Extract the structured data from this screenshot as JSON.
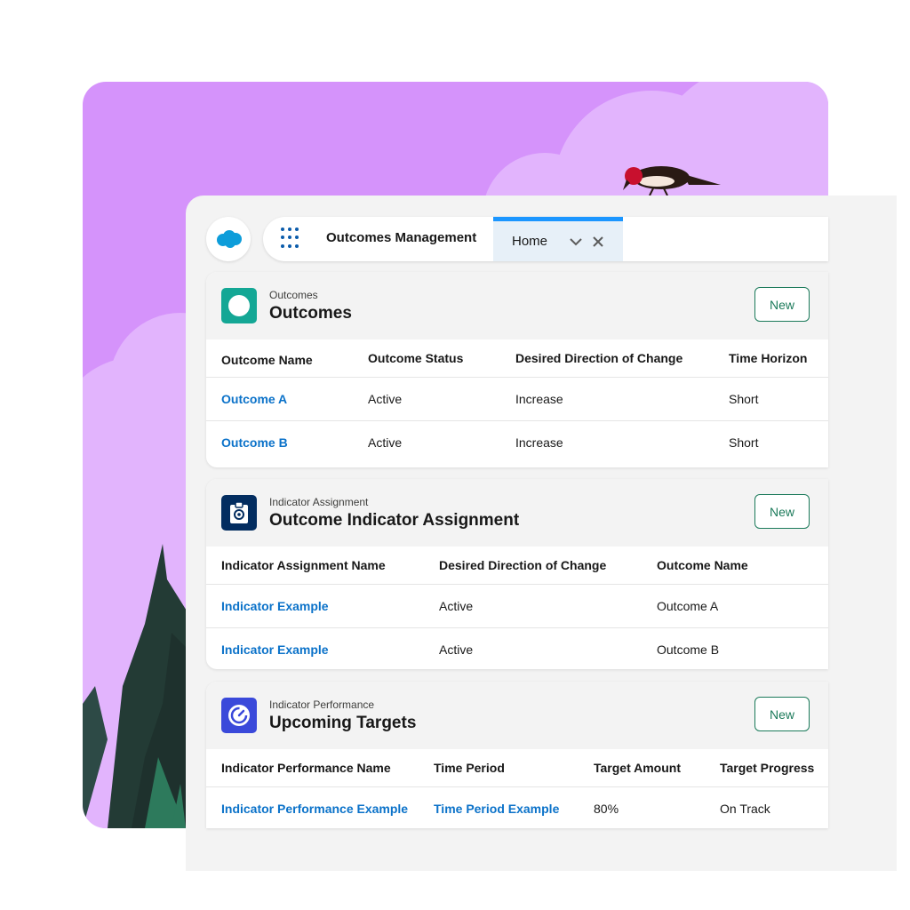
{
  "header": {
    "app_name": "Outcomes Management",
    "tab_label": "Home"
  },
  "colors": {
    "background": "#d593fb",
    "outcomes_icon": "#14a795",
    "indicator_assignment_icon": "#032d60",
    "indicator_performance_icon": "#3a49da",
    "link": "#0b72c9",
    "accent": "#1b96ff",
    "new_button": "#1b7a5a"
  },
  "icons": {
    "logo": "salesforce-cloud-logo",
    "app_launcher": "waffle-grid-icon",
    "tab_menu": "chevron-down-icon",
    "tab_close": "close-icon",
    "outcomes": "circle-icon",
    "indicator_assignment": "clipboard-icon",
    "indicator_performance": "gauge-icon"
  },
  "outcomes": {
    "eyebrow": "Outcomes",
    "title": "Outcomes",
    "new_label": "New",
    "columns": [
      "Outcome Name",
      "Outcome Status",
      "Desired Direction of Change",
      "Time Horizon"
    ],
    "rows": [
      [
        "Outcome A",
        "Active",
        "Increase",
        "Short"
      ],
      [
        "Outcome B",
        "Active",
        "Increase",
        "Short"
      ]
    ]
  },
  "assignment": {
    "eyebrow": "Indicator Assignment",
    "title": "Outcome Indicator Assignment",
    "new_label": "New",
    "columns": [
      "Indicator Assignment Name",
      "Desired Direction of Change",
      "Outcome Name"
    ],
    "rows": [
      [
        "Indicator Example",
        "Active",
        "Outcome A"
      ],
      [
        "Indicator Example",
        "Active",
        "Outcome B"
      ]
    ]
  },
  "performance": {
    "eyebrow": "Indicator Performance",
    "title": "Upcoming Targets",
    "new_label": "New",
    "columns": [
      "Indicator Performance Name",
      "Time Period",
      "Target Amount",
      "Target Progress"
    ],
    "rows": [
      [
        "Indicator Performance Example",
        "Time Period Example",
        "80%",
        "On Track"
      ]
    ]
  }
}
